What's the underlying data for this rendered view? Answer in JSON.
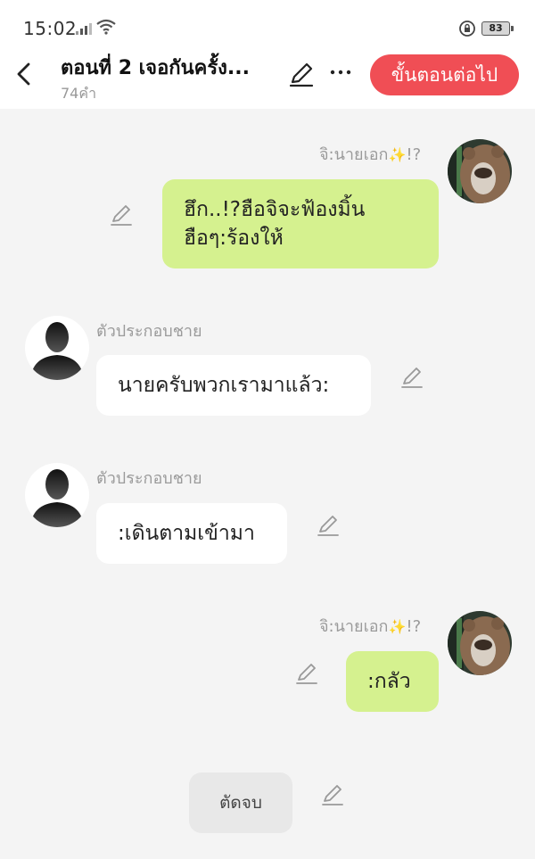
{
  "status_bar": {
    "time": "15:02",
    "battery": "83"
  },
  "header": {
    "title": "ตอนที่ 2 เจอกันครั้ง...",
    "word_count": "74คำ",
    "next_label": "ขั้นตอนต่อไป",
    "accent_color": "#f04e55"
  },
  "messages": [
    {
      "side": "right",
      "sender": "จิ:นายเอก",
      "sender_suffix": "!?",
      "text": "ฮึก..!?ฮือจิจะฟ้องมิ้น\nฮือๆ:ร้องให้",
      "bubble_color": "#d5f18f"
    },
    {
      "side": "left",
      "sender": "ตัวประกอบชาย",
      "text": "นายครับพวกเรามาแล้ว:",
      "bubble_color": "#ffffff"
    },
    {
      "side": "left",
      "sender": "ตัวประกอบชาย",
      "text": ":เดินตามเข้ามา",
      "bubble_color": "#ffffff"
    },
    {
      "side": "right",
      "sender": "จิ:นายเอก",
      "sender_suffix": "!?",
      "text": ":กลัว",
      "bubble_color": "#d5f18f"
    }
  ],
  "end_button": {
    "label": "ตัดจบ"
  },
  "icons": {
    "back": "chevron-left-icon",
    "edit": "pencil-icon",
    "more": "more-horizontal-icon",
    "sparkle": "sparkles-icon"
  }
}
